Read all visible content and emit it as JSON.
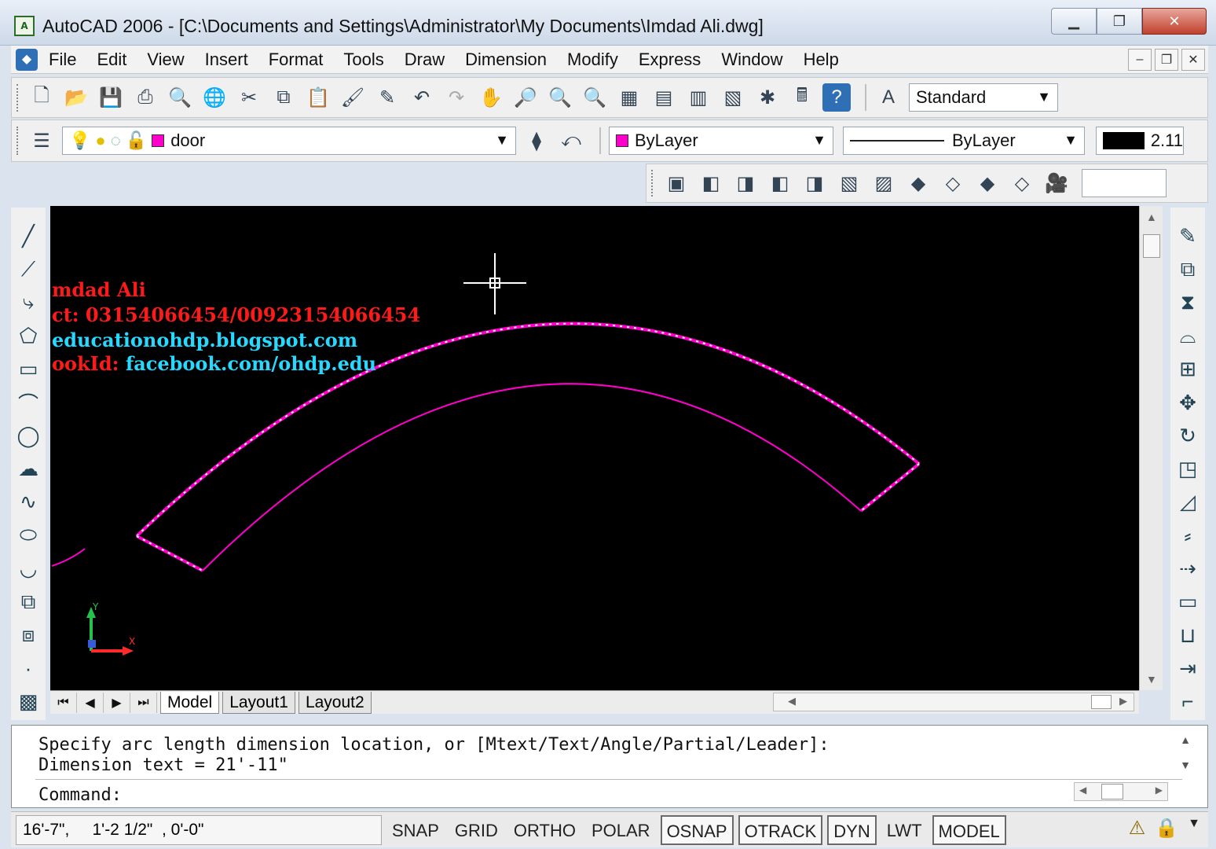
{
  "window": {
    "title": "AutoCAD 2006 - [C:\\Documents and Settings\\Administrator\\My Documents\\Imdad Ali.dwg]"
  },
  "menu": [
    "File",
    "Edit",
    "View",
    "Insert",
    "Format",
    "Tools",
    "Draw",
    "Dimension",
    "Modify",
    "Express",
    "Window",
    "Help"
  ],
  "standard_toolbar": {
    "text_style": "Standard"
  },
  "layers_toolbar": {
    "current_layer": "door"
  },
  "properties_toolbar": {
    "color": "ByLayer",
    "linetype": "ByLayer",
    "lineweight_value": "2.11"
  },
  "drawing": {
    "watermark": {
      "line1": "mdad Ali",
      "line2": "ct: 03154066454/00923154066454",
      "line3": "educationohdp.blogspot.com",
      "line4_label": "ookId:",
      "line4_value": "facebook.com/ohdp.edu"
    },
    "colors": {
      "background": "#000000",
      "arc": "#ff00cc",
      "grip": "#ffffff",
      "watermark_red": "#ff1a1a",
      "watermark_cyan": "#27d8ff"
    },
    "ucs": {
      "x_label": "X",
      "y_label": "Y"
    }
  },
  "tabs": {
    "model": "Model",
    "layout1": "Layout1",
    "layout2": "Layout2"
  },
  "command": {
    "line1": "Specify arc length dimension location, or [Mtext/Text/Angle/Partial/Leader]:",
    "line2": "Dimension text = 21'-11\"",
    "prompt": "Command:"
  },
  "status": {
    "coords": "16'-7\",     1'-2 1/2\"  , 0'-0\"",
    "buttons": {
      "snap": "SNAP",
      "grid": "GRID",
      "ortho": "ORTHO",
      "polar": "POLAR",
      "osnap": "OSNAP",
      "otrack": "OTRACK",
      "dyn": "DYN",
      "lwt": "LWT",
      "model": "MODEL"
    }
  }
}
